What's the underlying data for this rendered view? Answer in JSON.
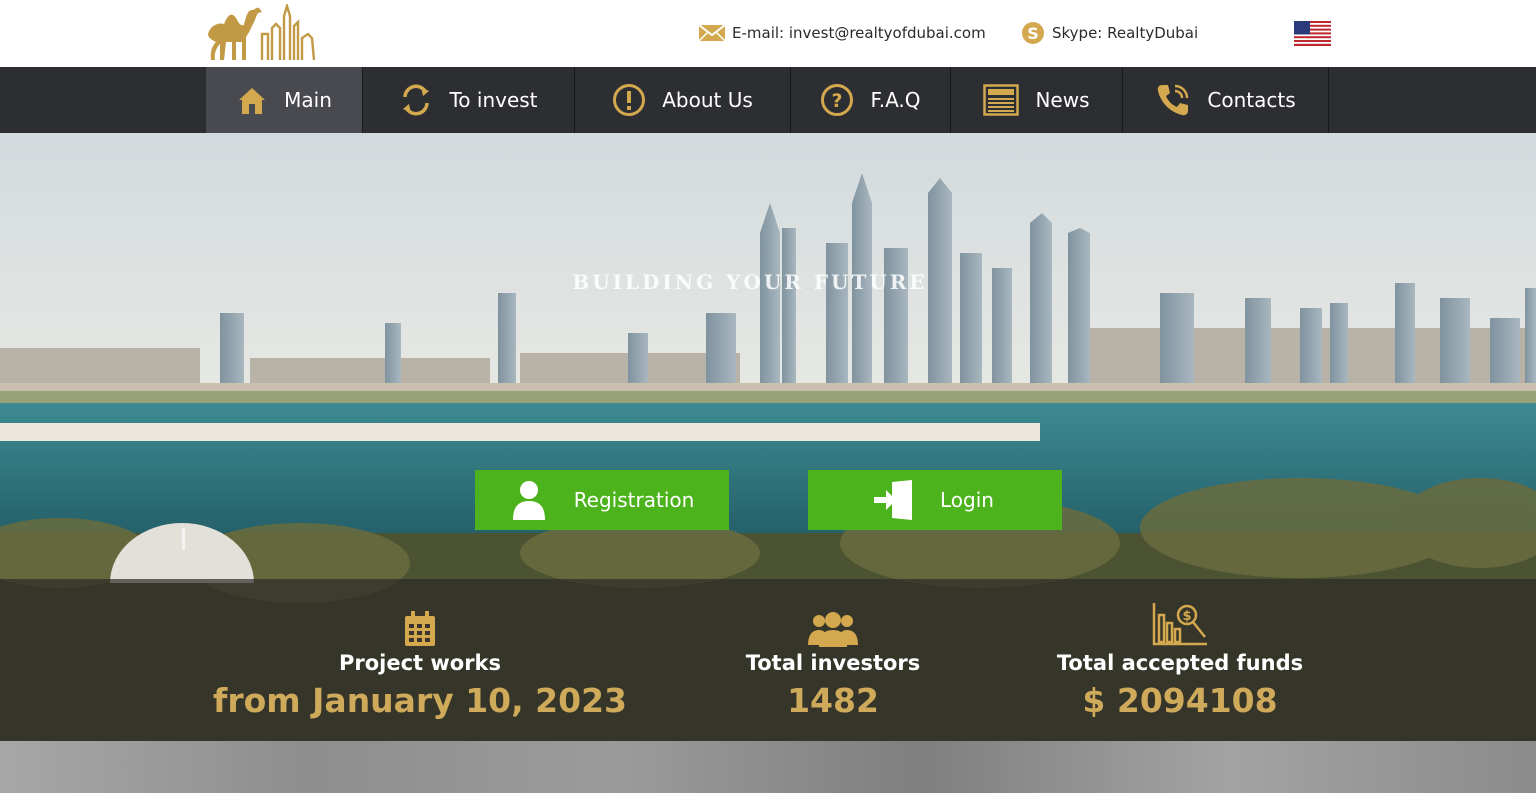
{
  "header": {
    "logo_icon": "camel-skyline-logo",
    "email_text": "E-mail: invest@realtyofdubai.com",
    "email_icon": "envelope-icon",
    "skype_text": "Skype: RealtyDubai",
    "skype_icon": "skype-icon",
    "language_icon": "us-flag-icon"
  },
  "nav": {
    "items": [
      {
        "label": "Main",
        "icon": "home-icon",
        "active": true
      },
      {
        "label": "To invest",
        "icon": "refresh-icon"
      },
      {
        "label": "About Us",
        "icon": "info-exclamation-icon"
      },
      {
        "label": "F.A.Q",
        "icon": "question-icon"
      },
      {
        "label": "News",
        "icon": "newspaper-icon"
      },
      {
        "label": "Contacts",
        "icon": "phone-icon"
      }
    ]
  },
  "hero": {
    "tagline": "BUILDING YOUR FUTURE",
    "registration_label": "Registration",
    "login_label": "Login"
  },
  "stats": [
    {
      "label": "Project works",
      "value": "from January 10, 2023",
      "icon": "calendar-icon"
    },
    {
      "label": "Total investors",
      "value": "1482",
      "icon": "users-group-icon"
    },
    {
      "label": "Total accepted funds",
      "value": "$ 2094108",
      "icon": "funds-chart-icon"
    }
  ],
  "colors": {
    "accent_gold": "#c9a655",
    "nav_bg": "#2d2e32",
    "button_green": "#4db31d"
  }
}
